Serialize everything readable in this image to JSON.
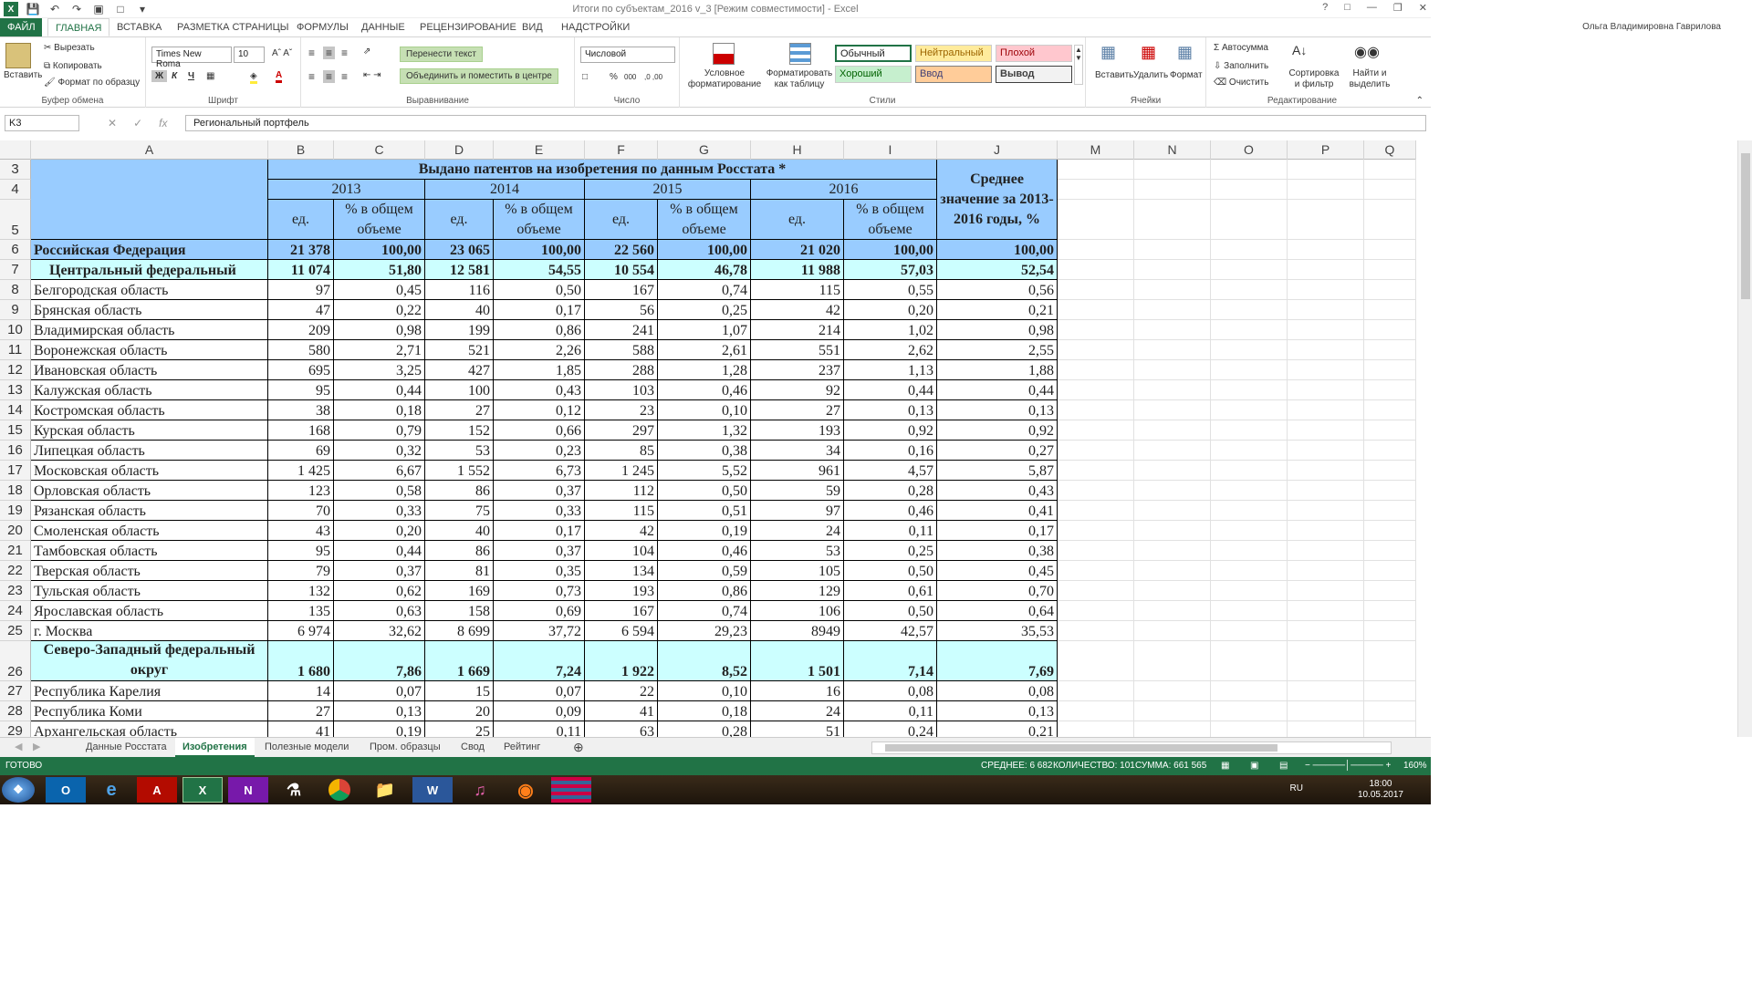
{
  "window": {
    "title": "Итоги по субъектам_2016 v_3  [Режим совместимости] - Excel",
    "user": "Ольга Владимировна Гаврилова"
  },
  "tabs": [
    "ФАЙЛ",
    "ГЛАВНАЯ",
    "ВСТАВКА",
    "РАЗМЕТКА СТРАНИЦЫ",
    "ФОРМУЛЫ",
    "ДАННЫЕ",
    "РЕЦЕНЗИРОВАНИЕ",
    "ВИД",
    "НАДСТРОЙКИ"
  ],
  "ribbon": {
    "clipboard": {
      "paste": "Вставить",
      "cut": "Вырезать",
      "copy": "Копировать",
      "format_painter": "Формат по образцу",
      "label": "Буфер обмена"
    },
    "font": {
      "name": "Times New Roma",
      "size": "10",
      "bold": "Ж",
      "italic": "К",
      "underline": "Ч",
      "label": "Шрифт"
    },
    "alignment": {
      "wrap": "Перенести текст",
      "merge": "Объединить и поместить в центре",
      "label": "Выравнивание"
    },
    "number": {
      "format": "Числовой",
      "percent": "%",
      "thousands": "000",
      "label": "Число"
    },
    "styles": {
      "conditional": "Условное форматирование",
      "as_table": "Форматировать как таблицу",
      "normal": "Обычный",
      "neutral": "Нейтральный",
      "bad": "Плохой",
      "good": "Хороший",
      "input": "Ввод",
      "output": "Вывод",
      "label": "Стили"
    },
    "cells": {
      "insert": "Вставить",
      "delete": "Удалить",
      "format": "Формат",
      "label": "Ячейки"
    },
    "editing": {
      "autosum": "Автосумма",
      "fill": "Заполнить",
      "clear": "Очистить",
      "sort": "Сортировка и фильтр",
      "find": "Найти и выделить",
      "label": "Редактирование"
    }
  },
  "formula_bar": {
    "cell_ref": "K3",
    "fx": "fx",
    "content": "Региональный портфель"
  },
  "columns": [
    "A",
    "B",
    "C",
    "D",
    "E",
    "F",
    "G",
    "H",
    "I",
    "J",
    "M",
    "N",
    "O",
    "P",
    "Q"
  ],
  "table_header": {
    "title": "Выдано патентов на изобретения по данным Росстата *",
    "years": [
      "2013",
      "2014",
      "2015",
      "2016"
    ],
    "unit": "ед.",
    "share": "% в общем объеме",
    "avg": "Среднее значение за 2013-2016 годы, %"
  },
  "rows": [
    {
      "n": "6",
      "name": "Российская Федерация",
      "vals": [
        "21 378",
        "100,00",
        "23 065",
        "100,00",
        "22 560",
        "100,00",
        "21 020",
        "100,00",
        "100,00"
      ],
      "kind": "rf"
    },
    {
      "n": "7",
      "name": "Центральный федеральный",
      "vals": [
        "11 074",
        "51,80",
        "12 581",
        "54,55",
        "10 554",
        "46,78",
        "11 988",
        "57,03",
        "52,54"
      ],
      "kind": "fo"
    },
    {
      "n": "8",
      "name": "Белгородская область",
      "vals": [
        "97",
        "0,45",
        "116",
        "0,50",
        "167",
        "0,74",
        "115",
        "0,55",
        "0,56"
      ]
    },
    {
      "n": "9",
      "name": "Брянская область",
      "vals": [
        "47",
        "0,22",
        "40",
        "0,17",
        "56",
        "0,25",
        "42",
        "0,20",
        "0,21"
      ]
    },
    {
      "n": "10",
      "name": "Владимирская область",
      "vals": [
        "209",
        "0,98",
        "199",
        "0,86",
        "241",
        "1,07",
        "214",
        "1,02",
        "0,98"
      ]
    },
    {
      "n": "11",
      "name": "Воронежская область",
      "vals": [
        "580",
        "2,71",
        "521",
        "2,26",
        "588",
        "2,61",
        "551",
        "2,62",
        "2,55"
      ]
    },
    {
      "n": "12",
      "name": "Ивановская область",
      "vals": [
        "695",
        "3,25",
        "427",
        "1,85",
        "288",
        "1,28",
        "237",
        "1,13",
        "1,88"
      ]
    },
    {
      "n": "13",
      "name": "Калужская область",
      "vals": [
        "95",
        "0,44",
        "100",
        "0,43",
        "103",
        "0,46",
        "92",
        "0,44",
        "0,44"
      ]
    },
    {
      "n": "14",
      "name": "Костромская область",
      "vals": [
        "38",
        "0,18",
        "27",
        "0,12",
        "23",
        "0,10",
        "27",
        "0,13",
        "0,13"
      ]
    },
    {
      "n": "15",
      "name": "Курская область",
      "vals": [
        "168",
        "0,79",
        "152",
        "0,66",
        "297",
        "1,32",
        "193",
        "0,92",
        "0,92"
      ]
    },
    {
      "n": "16",
      "name": "Липецкая область",
      "vals": [
        "69",
        "0,32",
        "53",
        "0,23",
        "85",
        "0,38",
        "34",
        "0,16",
        "0,27"
      ]
    },
    {
      "n": "17",
      "name": "Московская область",
      "vals": [
        "1 425",
        "6,67",
        "1 552",
        "6,73",
        "1 245",
        "5,52",
        "961",
        "4,57",
        "5,87"
      ]
    },
    {
      "n": "18",
      "name": "Орловская область",
      "vals": [
        "123",
        "0,58",
        "86",
        "0,37",
        "112",
        "0,50",
        "59",
        "0,28",
        "0,43"
      ]
    },
    {
      "n": "19",
      "name": "Рязанская область",
      "vals": [
        "70",
        "0,33",
        "75",
        "0,33",
        "115",
        "0,51",
        "97",
        "0,46",
        "0,41"
      ]
    },
    {
      "n": "20",
      "name": "Смоленская область",
      "vals": [
        "43",
        "0,20",
        "40",
        "0,17",
        "42",
        "0,19",
        "24",
        "0,11",
        "0,17"
      ]
    },
    {
      "n": "21",
      "name": "Тамбовская область",
      "vals": [
        "95",
        "0,44",
        "86",
        "0,37",
        "104",
        "0,46",
        "53",
        "0,25",
        "0,38"
      ]
    },
    {
      "n": "22",
      "name": "Тверская область",
      "vals": [
        "79",
        "0,37",
        "81",
        "0,35",
        "134",
        "0,59",
        "105",
        "0,50",
        "0,45"
      ]
    },
    {
      "n": "23",
      "name": "Тульская область",
      "vals": [
        "132",
        "0,62",
        "169",
        "0,73",
        "193",
        "0,86",
        "129",
        "0,61",
        "0,70"
      ]
    },
    {
      "n": "24",
      "name": "Ярославская область",
      "vals": [
        "135",
        "0,63",
        "158",
        "0,69",
        "167",
        "0,74",
        "106",
        "0,50",
        "0,64"
      ]
    },
    {
      "n": "25",
      "name": "г. Москва",
      "vals": [
        "6 974",
        "32,62",
        "8 699",
        "37,72",
        "6 594",
        "29,23",
        "8949",
        "42,57",
        "35,53"
      ]
    },
    {
      "n": "26",
      "name": "Северо-Западный федеральный округ",
      "vals": [
        "1 680",
        "7,86",
        "1 669",
        "7,24",
        "1 922",
        "8,52",
        "1 501",
        "7,14",
        "7,69"
      ],
      "kind": "fo2"
    },
    {
      "n": "27",
      "name": "Республика Карелия",
      "vals": [
        "14",
        "0,07",
        "15",
        "0,07",
        "22",
        "0,10",
        "16",
        "0,08",
        "0,08"
      ]
    },
    {
      "n": "28",
      "name": "Республика Коми",
      "vals": [
        "27",
        "0,13",
        "20",
        "0,09",
        "41",
        "0,18",
        "24",
        "0,11",
        "0,13"
      ]
    },
    {
      "n": "29",
      "name": "Архангельская область",
      "vals": [
        "41",
        "0,19",
        "25",
        "0,11",
        "63",
        "0,28",
        "51",
        "0,24",
        "0,21"
      ]
    }
  ],
  "sheet_tabs": [
    "Данные Росстата",
    "Изобретения",
    "Полезные модели",
    "Пром. образцы",
    "Свод",
    "Рейтинг"
  ],
  "active_sheet": "Изобретения",
  "status": {
    "ready": "ГОТОВО",
    "average": "СРЕДНЕЕ: 6 682",
    "count": "КОЛИЧЕСТВО: 101",
    "sum": "СУММА: 661 565",
    "zoom": "160%"
  },
  "taskbar": {
    "lang": "RU",
    "time": "18:00",
    "date": "10.05.2017"
  },
  "colors": {
    "excel_green": "#217346",
    "header_blue": "#99ccff",
    "district_cyan": "#ccffff"
  }
}
